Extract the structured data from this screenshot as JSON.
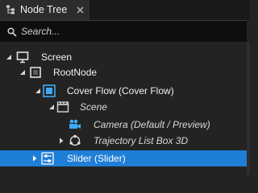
{
  "panel": {
    "tab_title": "Node Tree",
    "search_placeholder": "Search..."
  },
  "tree": [
    {
      "label": "Screen",
      "icon": "screen-icon"
    },
    {
      "label": "RootNode",
      "icon": "root-node-icon"
    },
    {
      "label": "Cover Flow (Cover Flow)",
      "icon": "cover-flow-icon"
    },
    {
      "label": "Scene",
      "icon": "scene-icon"
    },
    {
      "label": "Camera (Default / Preview)",
      "icon": "camera-icon"
    },
    {
      "label": "Trajectory List Box 3D",
      "icon": "trajectory-icon"
    },
    {
      "label": "Slider (Slider)",
      "icon": "slider-icon",
      "selected": true
    }
  ],
  "colors": {
    "selection": "#1f7ed6",
    "accent_icon": "#3fa9f5"
  }
}
